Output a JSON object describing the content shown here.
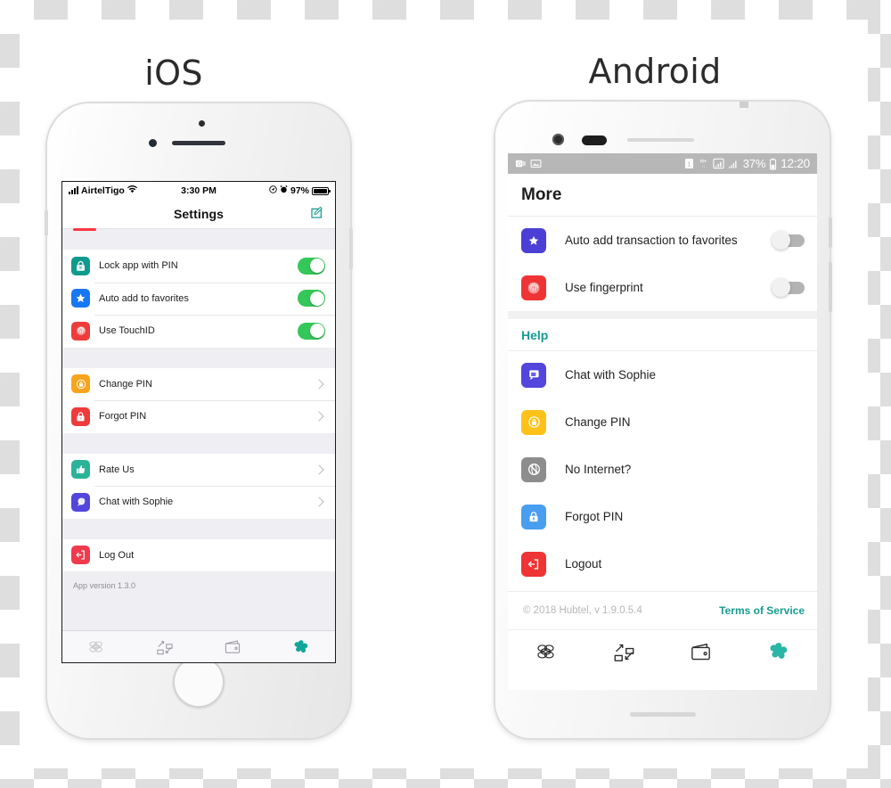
{
  "theme": {
    "teal": "#159c8f",
    "ios_switch_on": "#34c759",
    "android_link": "#159c8f",
    "red_indicator": "#fb3640"
  },
  "ios": {
    "os_label": "iOS",
    "status_bar": {
      "carrier": "AirtelTigo",
      "time": "3:30 PM",
      "battery_percent": "97%"
    },
    "nav": {
      "title": "Settings",
      "compose_icon": "compose-icon"
    },
    "toggle_section": [
      {
        "label": "Lock app with PIN",
        "icon": "lock-icon",
        "icon_color": "#0e9b8d",
        "state": "on"
      },
      {
        "label": "Auto add to favorites",
        "icon": "star-icon",
        "icon_color": "#1877f2",
        "state": "on"
      },
      {
        "label": "Use TouchID",
        "icon": "fingerprint-icon",
        "icon_color": "#ee3b3b",
        "state": "on"
      }
    ],
    "pin_section": [
      {
        "label": "Change PIN",
        "icon": "lock-circle-icon",
        "icon_color": "#f7a41d"
      },
      {
        "label": "Forgot PIN",
        "icon": "lock-question-icon",
        "icon_color": "#ef3b3b"
      }
    ],
    "help_section": [
      {
        "label": "Rate Us",
        "icon": "thumbs-up-icon",
        "icon_color": "#2bb39a"
      },
      {
        "label": "Chat with Sophie",
        "icon": "chat-icon",
        "icon_color": "#5246dd"
      }
    ],
    "logout_section": [
      {
        "label": "Log Out",
        "icon": "logout-icon",
        "icon_color": "#ef3b4c"
      }
    ],
    "version_text": "App version 1.3.0",
    "tabs": [
      {
        "name": "cloud-icon",
        "active": false
      },
      {
        "name": "transfer-icon",
        "active": false
      },
      {
        "name": "wallet-icon",
        "active": false
      },
      {
        "name": "hubtel-icon",
        "active": true
      }
    ]
  },
  "android": {
    "os_label": "Android",
    "status_bar": {
      "sim_icon": "sim-icon",
      "network_type": "H+",
      "battery_percent": "37%",
      "time": "12:20"
    },
    "appbar": {
      "title": "More"
    },
    "toggle_section": [
      {
        "label": "Auto add transaction to favorites",
        "icon": "star-icon",
        "icon_color": "#4b3fd6",
        "state": "off"
      },
      {
        "label": "Use fingerprint",
        "icon": "fingerprint-icon",
        "icon_color": "#ee3434",
        "state": "off"
      }
    ],
    "help_header": "Help",
    "help_section": [
      {
        "label": "Chat with Sophie",
        "icon": "chat-icon",
        "icon_color": "#5246dd"
      },
      {
        "label": "Change PIN",
        "icon": "lock-circle-icon",
        "icon_color": "#fcc219"
      },
      {
        "label": "No Internet?",
        "icon": "no-internet-icon",
        "icon_color": "#8d8d8d"
      },
      {
        "label": "Forgot PIN",
        "icon": "lock-icon",
        "icon_color": "#4a9ef0"
      },
      {
        "label": "Logout",
        "icon": "logout-icon",
        "icon_color": "#ee3434"
      }
    ],
    "footer": {
      "copyright": "© 2018 Hubtel, v 1.9.0.5.4",
      "terms_link": "Terms of Service"
    },
    "tabs": [
      {
        "name": "cloud-icon",
        "active": false
      },
      {
        "name": "transfer-icon",
        "active": false
      },
      {
        "name": "wallet-icon",
        "active": false
      },
      {
        "name": "hubtel-icon",
        "active": true
      }
    ]
  }
}
